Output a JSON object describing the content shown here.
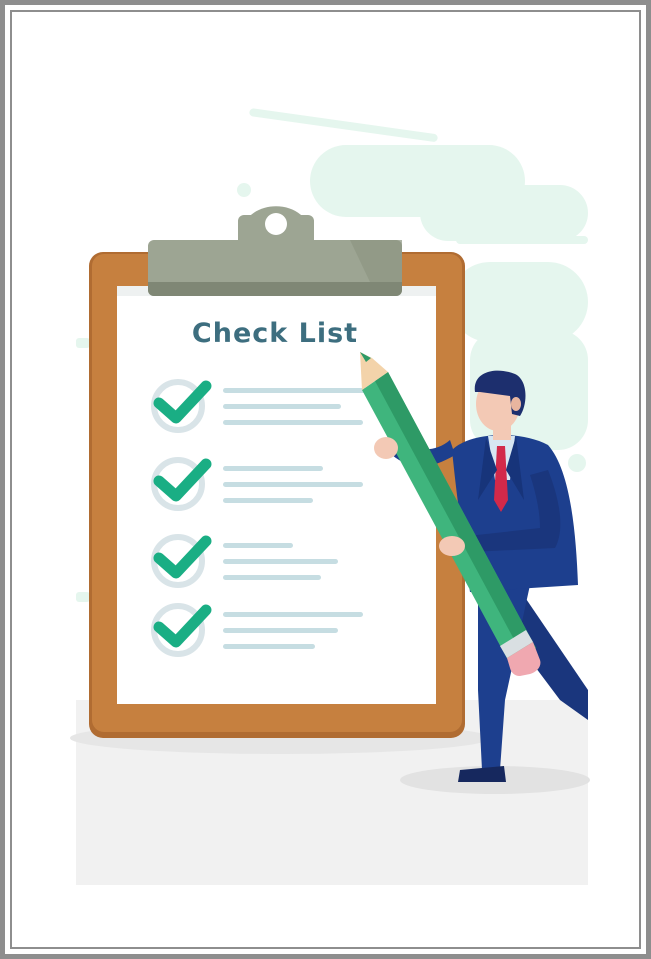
{
  "illustration": {
    "title": "Check List"
  },
  "colors": {
    "frame": "#8e8e8e",
    "background": "#ffffff",
    "mint": "#e5f6ee",
    "ground": "#eeeeee",
    "board": "#c6803f",
    "board_edge": "#b06c32",
    "clip": "#9da593",
    "clip_shadow": "#7f8775",
    "paper": "#ffffff",
    "title": "#3d6e7f",
    "check": "#1aae84",
    "check_ring": "#d9e4e8",
    "lines": "#c6dde2",
    "pencil": "#3fb57d",
    "pencil_dark": "#2e9a66",
    "eraser": "#f0a8b0",
    "suit": "#1d3f8e",
    "shirt": "#d7e6f2",
    "tie": "#d2294a",
    "skin": "#f3c9b5",
    "hair": "#1d2f6e"
  },
  "checklist": {
    "items": [
      {
        "checked": true
      },
      {
        "checked": true
      },
      {
        "checked": true
      },
      {
        "checked": true
      }
    ]
  }
}
